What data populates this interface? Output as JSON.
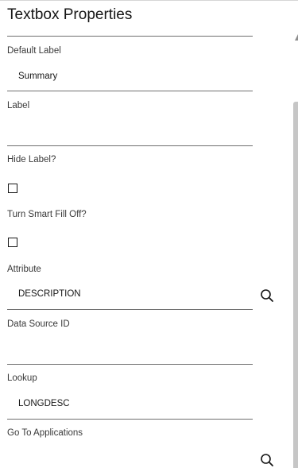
{
  "panel": {
    "title": "Textbox Properties"
  },
  "fields": {
    "default_label": {
      "label": "Default Label",
      "value": "Summary"
    },
    "label": {
      "label": "Label",
      "value": ""
    },
    "hide_label": {
      "label": "Hide Label?",
      "checked": false
    },
    "turn_smart_fill_off": {
      "label": "Turn Smart Fill Off?",
      "checked": false
    },
    "attribute": {
      "label": "Attribute",
      "value": "DESCRIPTION"
    },
    "data_source_id": {
      "label": "Data Source ID",
      "value": ""
    },
    "lookup": {
      "label": "Lookup",
      "value": "LONGDESC"
    },
    "go_to_applications": {
      "label": "Go To Applications",
      "value": ""
    }
  },
  "icons": {
    "search": "search-icon"
  }
}
